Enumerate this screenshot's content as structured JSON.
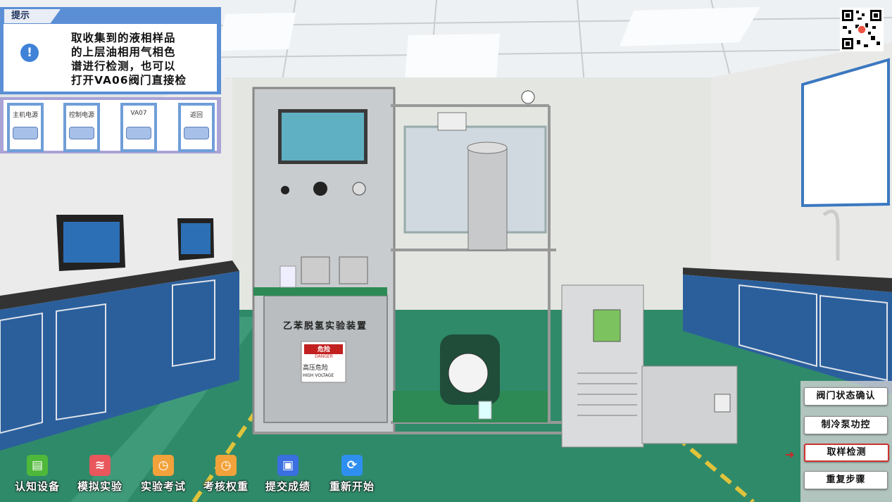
{
  "hint": {
    "title": "提示",
    "icon": "info-icon",
    "lines": [
      "取收集到的液相样品",
      "的上层油相用气相色",
      "谱进行检测，也可以",
      "打开VA06阀门直接检"
    ]
  },
  "controls": [
    {
      "label": "主机电源"
    },
    {
      "label": "控制电源"
    },
    {
      "label": "VA07"
    },
    {
      "label": "返回"
    }
  ],
  "device": {
    "name": "乙苯脱氢实验装置",
    "warning_title": "危险",
    "warning_sub": "DANGER",
    "warning_text": "高压危险",
    "warning_text_en": "HIGH VOLTAGE"
  },
  "right_buttons": [
    {
      "label": "阀门状态确认",
      "active": false
    },
    {
      "label": "制冷泵功控",
      "active": false
    },
    {
      "label": "取样检测",
      "active": true
    },
    {
      "label": "重复步骤",
      "active": false
    }
  ],
  "toolbar": [
    {
      "label": "认知设备",
      "icon": "document-icon",
      "color": "#4fb83a",
      "glyph": "▤"
    },
    {
      "label": "模拟实验",
      "icon": "layers-icon",
      "color": "#e8575c",
      "glyph": "≋"
    },
    {
      "label": "实验考试",
      "icon": "exam-icon",
      "color": "#f2a23a",
      "glyph": "◷"
    },
    {
      "label": "考核权重",
      "icon": "weight-icon",
      "color": "#f2a23a",
      "glyph": "◷"
    },
    {
      "label": "提交成绩",
      "icon": "save-icon",
      "color": "#3a6fe0",
      "glyph": "▣"
    },
    {
      "label": "重新开始",
      "icon": "restart-icon",
      "color": "#2f8ff0",
      "glyph": "⟳"
    }
  ]
}
